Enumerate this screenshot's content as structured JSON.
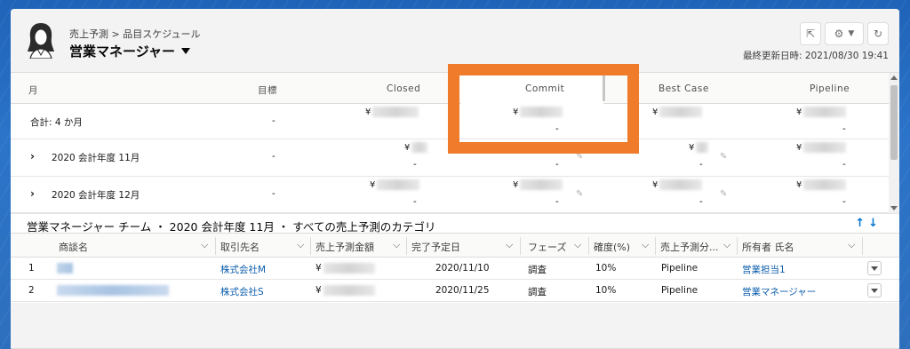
{
  "header": {
    "breadcrumb": "売上予測 > 品目スケジュール",
    "title": "営業マネージャー",
    "last_updated": "最終更新日時: 2021/08/30 19:41"
  },
  "forecast_columns": [
    "月",
    "目標",
    "Closed",
    "Commit",
    "Best Case",
    "Pipeline"
  ],
  "forecast_rows": [
    {
      "label": "合計: 4 か月",
      "target": "-",
      "expandable": false,
      "values": [
        "¥",
        "¥",
        "¥",
        "¥"
      ],
      "sub": [
        "",
        "-",
        "",
        "-"
      ]
    },
    {
      "label": "2020 会計年度 11月",
      "target": "-",
      "expandable": true,
      "values": [
        "¥",
        "",
        "¥",
        "¥"
      ],
      "sub": [
        "-",
        "-",
        "-",
        "-"
      ]
    },
    {
      "label": "2020 会計年度 12月",
      "target": "-",
      "expandable": true,
      "values": [
        "¥",
        "¥",
        "¥",
        "¥"
      ],
      "sub": [
        "-",
        "-",
        "-",
        "-"
      ]
    }
  ],
  "panel": {
    "title": "営業マネージャー チーム ・ 2020 会計年度 11月 ・ すべての売上予測のカテゴリ",
    "sort_arrows": "↑↓"
  },
  "table": {
    "headers": [
      "商談名",
      "取引先名",
      "売上予測金額",
      "完了予定日",
      "フェーズ",
      "確度(%)",
      "売上予測分...",
      "所有者 氏名"
    ],
    "rows": [
      {
        "num": "1",
        "account": "株式会社M",
        "amount": "¥",
        "date": "2020/11/10",
        "phase": "調査",
        "prob": "10%",
        "category": "Pipeline",
        "owner": "営業担当1"
      },
      {
        "num": "2",
        "account": "株式会社S",
        "amount": "¥",
        "date": "2020/11/25",
        "phase": "調査",
        "prob": "10%",
        "category": "Pipeline",
        "owner": "営業マネージャー"
      }
    ]
  },
  "colors": {
    "accent": "#0176d3",
    "highlight": "#ef7b2b",
    "link": "#0b5cab"
  }
}
